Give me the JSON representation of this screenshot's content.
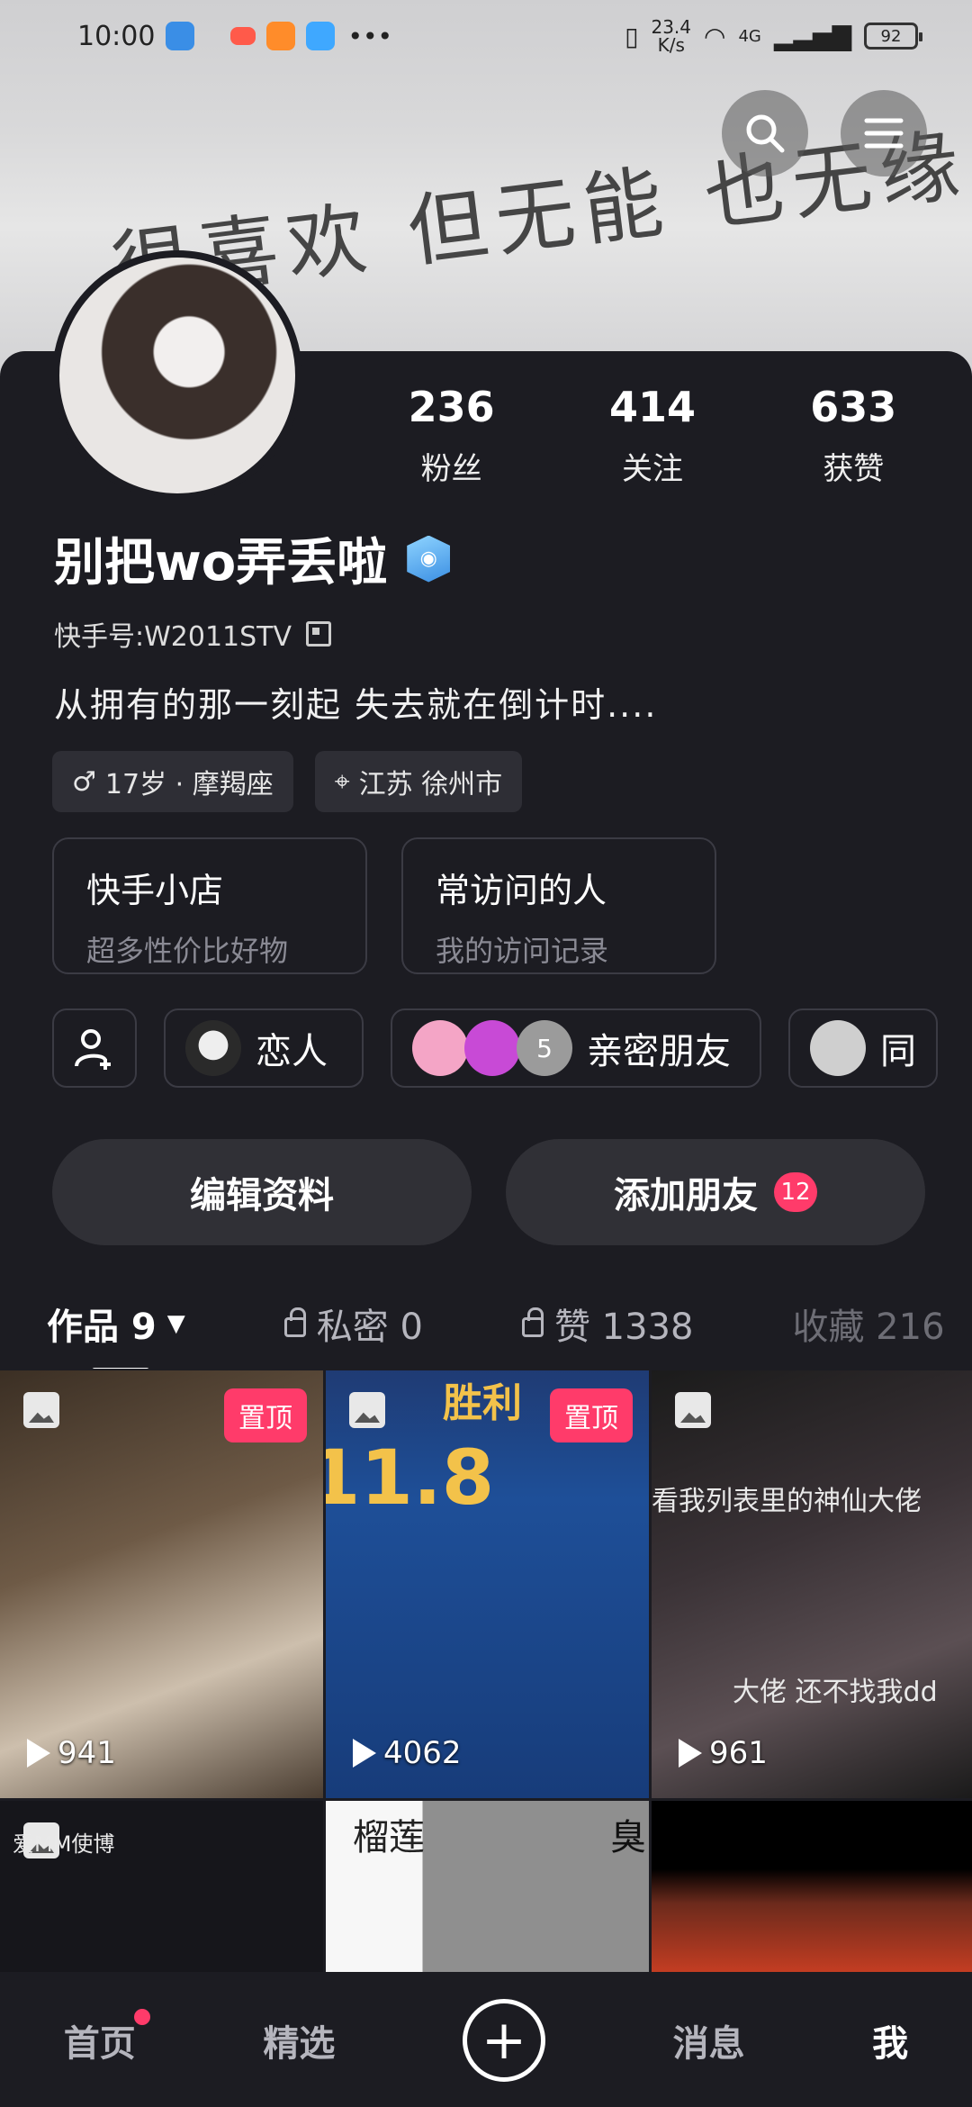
{
  "status": {
    "time": "10:00",
    "net_speed": "23.4",
    "net_unit": "K/s",
    "net_type": "4G",
    "battery": "92"
  },
  "banner": {
    "text": "很喜欢 但无能 也无缘"
  },
  "profile": {
    "name": "别把wo弄丢啦",
    "kuaishou_id": "快手号:W2011STV",
    "bio": "从拥有的那一刻起  失去就在倒计时....",
    "tags": [
      {
        "label": "17岁 · 摩羯座"
      },
      {
        "label": "江苏 徐州市"
      }
    ],
    "stats": [
      {
        "num": "236",
        "label": "粉丝"
      },
      {
        "num": "414",
        "label": "关注"
      },
      {
        "num": "633",
        "label": "获赞"
      }
    ]
  },
  "boxes": [
    {
      "title": "快手小店",
      "sub": "超多性价比好物"
    },
    {
      "title": "常访问的人",
      "sub": "我的访问记录"
    }
  ],
  "friends": {
    "lover": "恋人",
    "close": "亲密朋友",
    "close_count": "5",
    "partial": "同"
  },
  "actions": {
    "edit": "编辑资料",
    "add_friend": "添加朋友",
    "add_badge": "12"
  },
  "tabs": [
    {
      "label": "作品 9"
    },
    {
      "label": "私密 0"
    },
    {
      "label": "赞 1338"
    },
    {
      "label": "收藏 216"
    }
  ],
  "grid": [
    {
      "pinned": "置顶",
      "plays": "941"
    },
    {
      "pinned": "置顶",
      "plays": "4062",
      "big": "11.8",
      "sub": "胜利"
    },
    {
      "plays": "961",
      "overlay1": "看我列表里的神仙大佬",
      "overlay2": "大佬 还不找我dd"
    },
    {
      "overlay": "爱MM使博"
    },
    {
      "overlay1": "榴莲",
      "overlay2": "臭"
    },
    {}
  ],
  "nav": [
    {
      "label": "首页"
    },
    {
      "label": "精选"
    },
    {
      "label": "消息"
    },
    {
      "label": "我"
    }
  ],
  "colors": {
    "accent": "#ff3b6a",
    "bg": "#1c1c22"
  }
}
